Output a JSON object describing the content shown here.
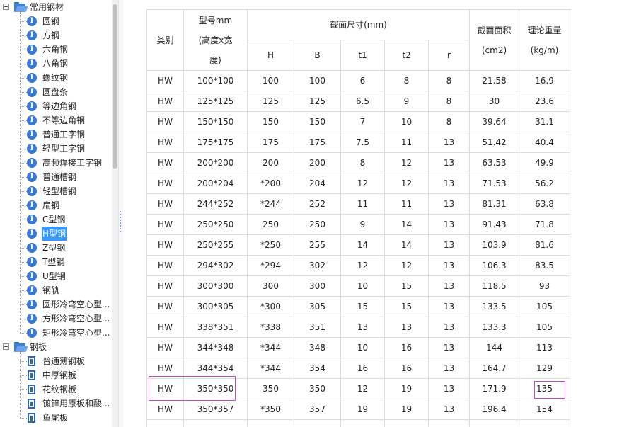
{
  "tree": {
    "groups": [
      {
        "label": "常用钢材",
        "items": [
          {
            "label": "圆钢",
            "icon": "info-icon"
          },
          {
            "label": "方钢",
            "icon": "info-icon"
          },
          {
            "label": "六角钢",
            "icon": "info-icon"
          },
          {
            "label": "八角钢",
            "icon": "info-icon"
          },
          {
            "label": "螺纹钢",
            "icon": "info-icon"
          },
          {
            "label": "圆盘条",
            "icon": "info-icon"
          },
          {
            "label": "等边角钢",
            "icon": "info-icon"
          },
          {
            "label": "不等边角钢",
            "icon": "info-icon"
          },
          {
            "label": "普通工字钢",
            "icon": "info-icon"
          },
          {
            "label": "轻型工字钢",
            "icon": "info-icon"
          },
          {
            "label": "高频焊接工字钢",
            "icon": "info-icon"
          },
          {
            "label": "普通槽钢",
            "icon": "info-icon"
          },
          {
            "label": "轻型槽钢",
            "icon": "info-icon"
          },
          {
            "label": "扁钢",
            "icon": "info-icon"
          },
          {
            "label": "C型钢",
            "icon": "info-icon"
          },
          {
            "label": "H型钢",
            "icon": "info-icon",
            "selected": true
          },
          {
            "label": "Z型钢",
            "icon": "info-icon"
          },
          {
            "label": "T型钢",
            "icon": "info-icon"
          },
          {
            "label": "U型钢",
            "icon": "info-icon"
          },
          {
            "label": "钢轨",
            "icon": "info-icon"
          },
          {
            "label": "圆形冷弯空心型...",
            "icon": "info-icon"
          },
          {
            "label": "方形冷弯空心型...",
            "icon": "info-icon"
          },
          {
            "label": "矩形冷弯空心型...",
            "icon": "info-icon"
          }
        ]
      },
      {
        "label": "钢板",
        "items": [
          {
            "label": "普通薄钢板",
            "icon": "document-icon"
          },
          {
            "label": "中厚钢板",
            "icon": "document-icon"
          },
          {
            "label": "花纹钢板",
            "icon": "document-icon"
          },
          {
            "label": "镀锌用原板和酸...",
            "icon": "document-icon"
          },
          {
            "label": "鱼尾板",
            "icon": "document-icon"
          }
        ]
      }
    ]
  },
  "table": {
    "headers": {
      "category": "类别",
      "model_lines": [
        "型号mm",
        "(高度x宽",
        "度)"
      ],
      "section_dims": "截面尺寸(mm)",
      "sub": [
        "H",
        "B",
        "t1",
        "t2",
        "r"
      ],
      "area_lines": [
        "截面面积",
        "(cm2)"
      ],
      "weight_lines": [
        "理论重量",
        "(kg/m)"
      ]
    },
    "rows": [
      [
        "HW",
        "100*100",
        "100",
        "100",
        "6",
        "8",
        "8",
        "21.58",
        "16.9"
      ],
      [
        "HW",
        "125*125",
        "125",
        "125",
        "6.5",
        "9",
        "8",
        "30",
        "23.6"
      ],
      [
        "HW",
        "150*150",
        "150",
        "150",
        "7",
        "10",
        "8",
        "39.64",
        "31.1"
      ],
      [
        "HW",
        "175*175",
        "175",
        "175",
        "7.5",
        "11",
        "13",
        "51.42",
        "40.4"
      ],
      [
        "HW",
        "200*200",
        "200",
        "200",
        "8",
        "12",
        "13",
        "63.53",
        "49.9"
      ],
      [
        "HW",
        "200*204",
        "*200",
        "204",
        "12",
        "12",
        "13",
        "71.53",
        "56.2"
      ],
      [
        "HW",
        "244*252",
        "*244",
        "252",
        "11",
        "11",
        "13",
        "81.31",
        "63.8"
      ],
      [
        "HW",
        "250*250",
        "250",
        "250",
        "9",
        "14",
        "13",
        "91.43",
        "71.8"
      ],
      [
        "HW",
        "250*255",
        "*250",
        "255",
        "14",
        "14",
        "13",
        "103.9",
        "81.6"
      ],
      [
        "HW",
        "294*302",
        "*294",
        "302",
        "12",
        "12",
        "13",
        "106.3",
        "83.5"
      ],
      [
        "HW",
        "300*300",
        "300",
        "300",
        "10",
        "15",
        "13",
        "118.5",
        "93"
      ],
      [
        "HW",
        "300*305",
        "*300",
        "305",
        "15",
        "15",
        "13",
        "133.5",
        "105"
      ],
      [
        "HW",
        "338*351",
        "*338",
        "351",
        "13",
        "13",
        "13",
        "133.3",
        "105"
      ],
      [
        "HW",
        "344*348",
        "*344",
        "348",
        "10",
        "16",
        "13",
        "144",
        "113"
      ],
      [
        "HW",
        "344*354",
        "*344",
        "354",
        "16",
        "16",
        "13",
        "164.7",
        "129"
      ],
      [
        "HW",
        "350*350",
        "350",
        "350",
        "12",
        "19",
        "13",
        "171.9",
        "135"
      ],
      [
        "HW",
        "350*357",
        "*350",
        "357",
        "19",
        "19",
        "13",
        "196.4",
        "154"
      ],
      [
        "",
        "",
        "",
        "",
        "",
        "",
        "",
        "",
        ""
      ]
    ],
    "highlight_color": "#cc44cc"
  }
}
